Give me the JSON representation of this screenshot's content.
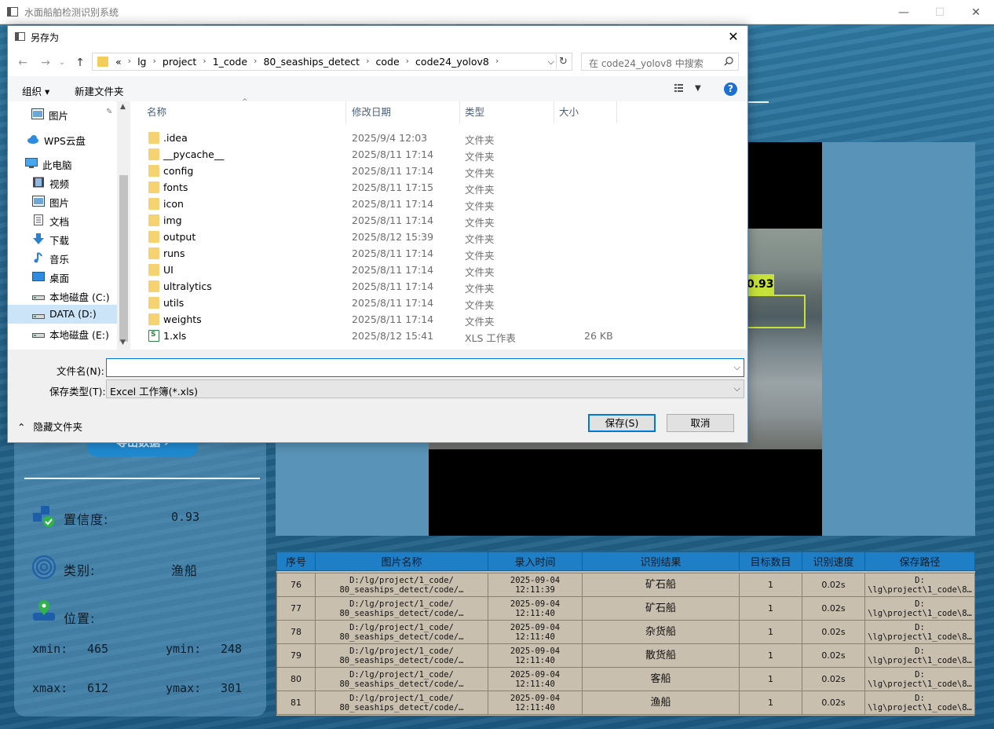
{
  "app": {
    "title": "水面船舶检测识别系统",
    "minimize": "—",
    "maximize": "☐",
    "close": "✕",
    "export_button": "导出数据",
    "confidence_label": "置信度:",
    "confidence_value": "0.93",
    "class_label": "类别:",
    "class_value": "渔船",
    "position_label": "位置:",
    "xmin_label": "xmin:",
    "xmin_value": "465",
    "ymin_label": "ymin:",
    "ymin_value": "248",
    "xmax_label": "xmax:",
    "xmax_value": "612",
    "ymax_label": "ymax:",
    "ymax_value": "301",
    "detection_label": "0.93",
    "detection_color": "#c6e23a"
  },
  "table": {
    "headers": [
      "序号",
      "图片名称",
      "录入时间",
      "识别结果",
      "目标数目",
      "识别速度",
      "保存路径"
    ],
    "rows": [
      {
        "id": "76",
        "name1": "D:/lg/project/1_code/",
        "name2": "80_seaships_detect/code/…",
        "date": "2025-09-04",
        "time": "12:11:39",
        "result": "矿石船",
        "count": "1",
        "speed": "0.02s",
        "path1": "D:",
        "path2": "\\lg\\project\\1_code\\8…"
      },
      {
        "id": "77",
        "name1": "D:/lg/project/1_code/",
        "name2": "80_seaships_detect/code/…",
        "date": "2025-09-04",
        "time": "12:11:40",
        "result": "矿石船",
        "count": "1",
        "speed": "0.02s",
        "path1": "D:",
        "path2": "\\lg\\project\\1_code\\8…"
      },
      {
        "id": "78",
        "name1": "D:/lg/project/1_code/",
        "name2": "80_seaships_detect/code/…",
        "date": "2025-09-04",
        "time": "12:11:40",
        "result": "杂货船",
        "count": "1",
        "speed": "0.02s",
        "path1": "D:",
        "path2": "\\lg\\project\\1_code\\8…"
      },
      {
        "id": "79",
        "name1": "D:/lg/project/1_code/",
        "name2": "80_seaships_detect/code/…",
        "date": "2025-09-04",
        "time": "12:11:40",
        "result": "散货船",
        "count": "1",
        "speed": "0.02s",
        "path1": "D:",
        "path2": "\\lg\\project\\1_code\\8…"
      },
      {
        "id": "80",
        "name1": "D:/lg/project/1_code/",
        "name2": "80_seaships_detect/code/…",
        "date": "2025-09-04",
        "time": "12:11:40",
        "result": "客船",
        "count": "1",
        "speed": "0.02s",
        "path1": "D:",
        "path2": "\\lg\\project\\1_code\\8…"
      },
      {
        "id": "81",
        "name1": "D:/lg/project/1_code/",
        "name2": "80_seaships_detect/code/…",
        "date": "2025-09-04",
        "time": "12:11:40",
        "result": "渔船",
        "count": "1",
        "speed": "0.02s",
        "path1": "D:",
        "path2": "\\lg\\project\\1_code\\8…"
      }
    ]
  },
  "dialog": {
    "title": "另存为",
    "close": "✕",
    "back": "←",
    "forward": "→",
    "recent": "⌄",
    "up": "↑",
    "breadcrumb": [
      "«",
      "lg",
      "project",
      "1_code",
      "80_seaships_detect",
      "code",
      "code24_yolov8"
    ],
    "search_placeholder": "在 code24_yolov8 中搜索",
    "organize": "组织 ▾",
    "new_folder": "新建文件夹",
    "help": "?",
    "nav_items": [
      {
        "label": "图片",
        "icon": "pictures-icon",
        "pinned": true
      },
      {
        "label": "WPS云盘",
        "icon": "cloud-icon"
      },
      {
        "label": "此电脑",
        "icon": "computer-icon"
      },
      {
        "label": "视频",
        "icon": "video-icon"
      },
      {
        "label": "图片",
        "icon": "pictures-icon"
      },
      {
        "label": "文档",
        "icon": "documents-icon"
      },
      {
        "label": "下载",
        "icon": "download-icon"
      },
      {
        "label": "音乐",
        "icon": "music-icon"
      },
      {
        "label": "桌面",
        "icon": "desktop-icon"
      },
      {
        "label": "本地磁盘 (C:)",
        "icon": "drive-icon"
      },
      {
        "label": "DATA (D:)",
        "icon": "drive-icon",
        "selected": true
      },
      {
        "label": "本地磁盘 (E:)",
        "icon": "drive-icon"
      }
    ],
    "columns": [
      "名称",
      "修改日期",
      "类型",
      "大小"
    ],
    "files": [
      {
        "name": ".idea",
        "date": "2025/9/4 12:03",
        "type": "文件夹",
        "size": ""
      },
      {
        "name": "__pycache__",
        "date": "2025/8/11 17:14",
        "type": "文件夹",
        "size": ""
      },
      {
        "name": "config",
        "date": "2025/8/11 17:14",
        "type": "文件夹",
        "size": ""
      },
      {
        "name": "fonts",
        "date": "2025/8/11 17:15",
        "type": "文件夹",
        "size": ""
      },
      {
        "name": "icon",
        "date": "2025/8/11 17:14",
        "type": "文件夹",
        "size": ""
      },
      {
        "name": "img",
        "date": "2025/8/11 17:14",
        "type": "文件夹",
        "size": ""
      },
      {
        "name": "output",
        "date": "2025/8/12 15:39",
        "type": "文件夹",
        "size": ""
      },
      {
        "name": "runs",
        "date": "2025/8/11 17:14",
        "type": "文件夹",
        "size": ""
      },
      {
        "name": "UI",
        "date": "2025/8/11 17:14",
        "type": "文件夹",
        "size": ""
      },
      {
        "name": "ultralytics",
        "date": "2025/8/11 17:14",
        "type": "文件夹",
        "size": ""
      },
      {
        "name": "utils",
        "date": "2025/8/11 17:14",
        "type": "文件夹",
        "size": ""
      },
      {
        "name": "weights",
        "date": "2025/8/11 17:14",
        "type": "文件夹",
        "size": ""
      },
      {
        "name": "1.xls",
        "date": "2025/8/12 15:41",
        "type": "XLS 工作表",
        "size": "26 KB",
        "xls": true
      }
    ],
    "filename_label": "文件名(N):",
    "filename_value": "",
    "filetype_label": "保存类型(T):",
    "filetype_value": "Excel 工作簿(*.xls)",
    "hide_folders": "隐藏文件夹",
    "save_button": "保存(S)",
    "cancel_button": "取消"
  }
}
